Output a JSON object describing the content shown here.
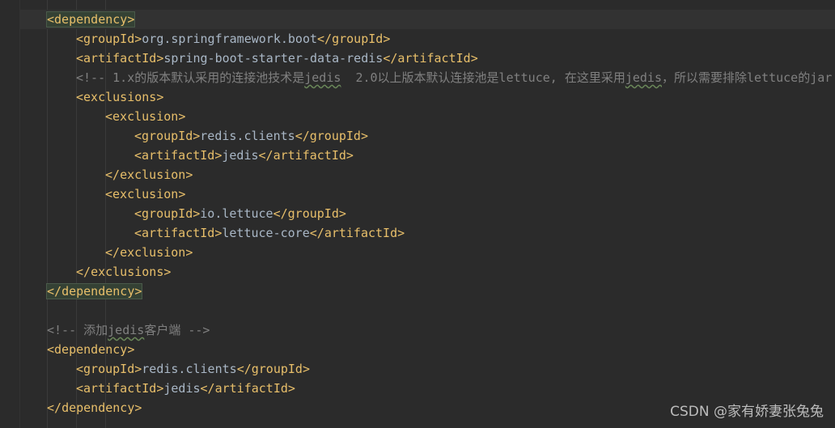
{
  "code": {
    "l1_open": "dependency",
    "l2_tag": "groupId",
    "l2_value": "org.springframework.boot",
    "l3_tag": "artifactId",
    "l3_value": "spring-boot-starter-data-redis",
    "l4_comment_open": "<!-- 1.x的版本默认采用的连接池技术是",
    "l4_jedis": "jedis",
    "l4_comment_rest": "  2.0以上版本默认连接池是lettuce, 在这里采用",
    "l4_jedis2": "jedis",
    "l4_comment_end": "，所以需要排除lettuce的jar",
    "l5_tag": "exclusions",
    "l6_tag": "exclusion",
    "l7_tag": "groupId",
    "l7_value": "redis.clients",
    "l8_tag": "artifactId",
    "l8_value": "jedis",
    "l9_tag": "exclusion",
    "l10_tag": "exclusion",
    "l11_tag": "groupId",
    "l11_value": "io.lettuce",
    "l12_tag": "artifactId",
    "l12_value": "lettuce-core",
    "l13_tag": "exclusion",
    "l14_tag": "exclusions",
    "l15_tag": "dependency",
    "l17_comment_open": "<!-- 添加",
    "l17_jedis": "jedis",
    "l17_comment_end": "客户端 -->",
    "l18_tag": "dependency",
    "l19_tag": "groupId",
    "l19_value": "redis.clients",
    "l20_tag": "artifactId",
    "l20_value": "jedis",
    "l21_tag": "dependency"
  },
  "watermark": "CSDN @家有娇妻张兔兔",
  "colors": {
    "background": "#2b2b2b",
    "tag": "#e8bf6a",
    "text": "#a9b7c6",
    "comment": "#808080",
    "match_highlight": "#344134"
  }
}
